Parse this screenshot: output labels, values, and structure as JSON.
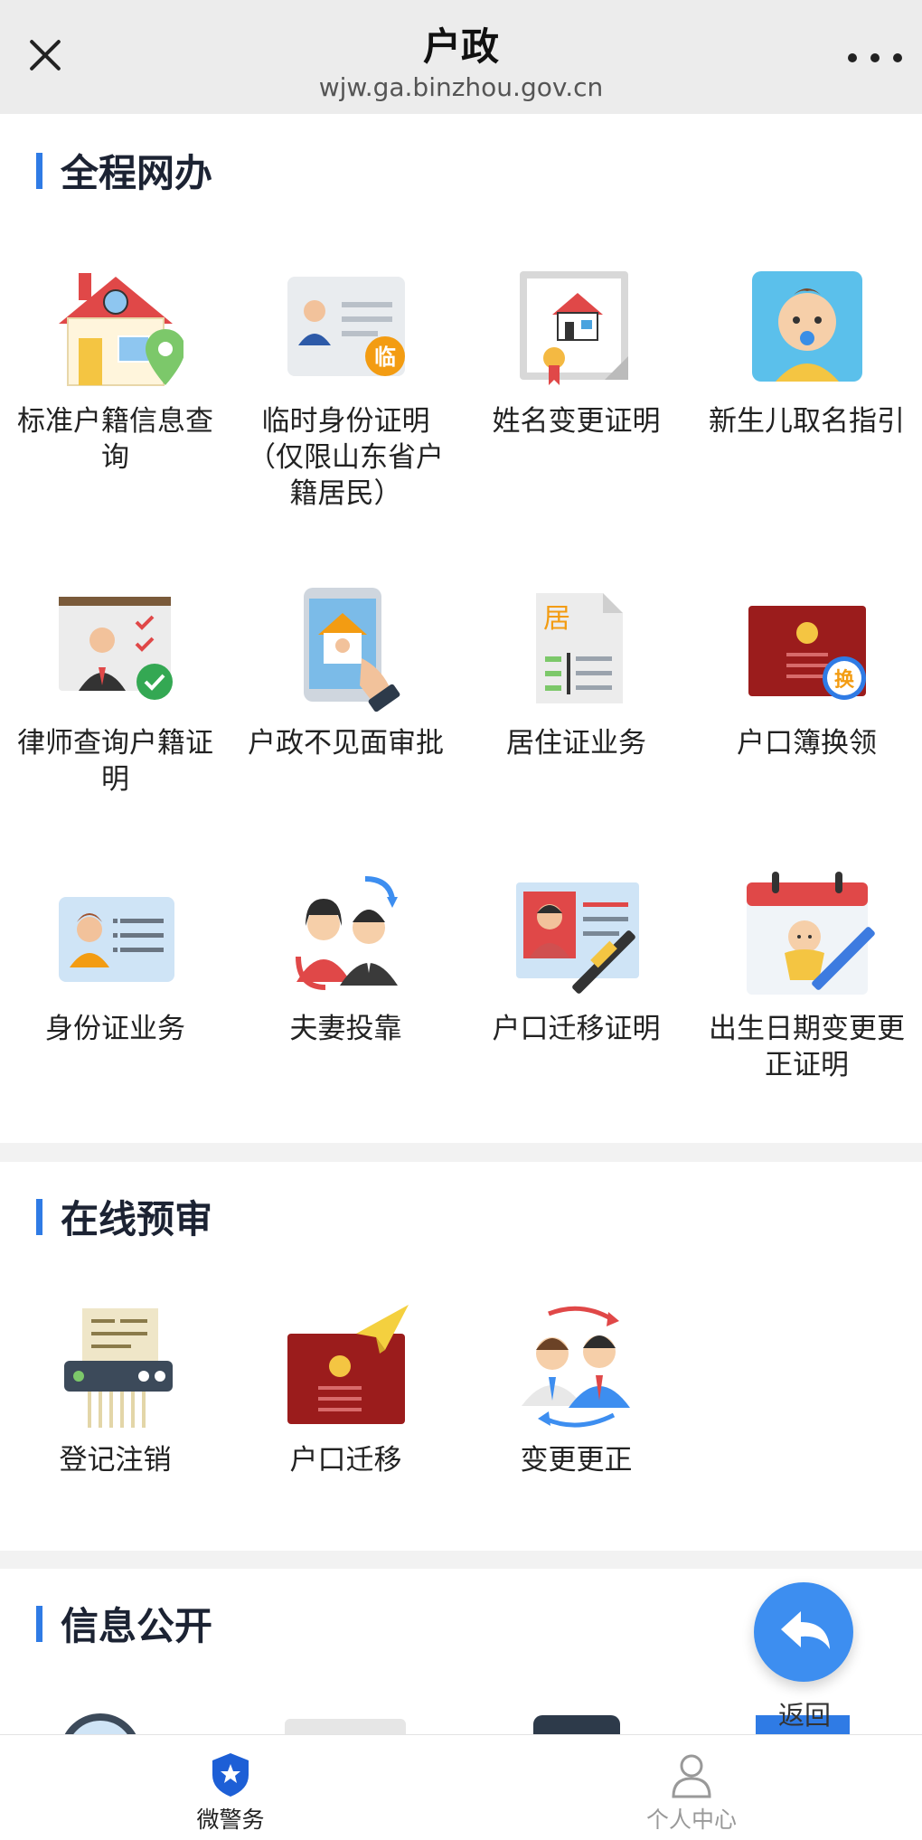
{
  "header": {
    "title": "户政",
    "url": "wjw.ga.binzhou.gov.cn"
  },
  "sections": {
    "full_online": {
      "title": "全程网办",
      "items": [
        {
          "label": "标准户籍信息查询",
          "icon": "house-location-icon"
        },
        {
          "label": "临时身份证明（仅限山东省户籍居民）",
          "icon": "temporary-id-card-icon"
        },
        {
          "label": "姓名变更证明",
          "icon": "certificate-house-icon"
        },
        {
          "label": "新生儿取名指引",
          "icon": "baby-icon"
        },
        {
          "label": "律师查询户籍证明",
          "icon": "lawyer-checklist-icon"
        },
        {
          "label": "户政不见面审批",
          "icon": "tablet-touch-icon"
        },
        {
          "label": "居住证业务",
          "icon": "residence-document-icon"
        },
        {
          "label": "户口簿换领",
          "icon": "household-book-exchange-icon"
        },
        {
          "label": "身份证业务",
          "icon": "id-card-icon"
        },
        {
          "label": "夫妻投靠",
          "icon": "couple-icon"
        },
        {
          "label": "户口迁移证明",
          "icon": "id-card-pen-icon"
        },
        {
          "label": "出生日期变更更正证明",
          "icon": "calendar-baby-icon"
        }
      ]
    },
    "online_review": {
      "title": "在线预审",
      "items": [
        {
          "label": "登记注销",
          "icon": "shredder-icon"
        },
        {
          "label": "户口迁移",
          "icon": "book-paper-plane-icon"
        },
        {
          "label": "变更更正",
          "icon": "people-swap-icon"
        }
      ]
    },
    "info_public": {
      "title": "信息公开"
    }
  },
  "float": {
    "return_label": "返回"
  },
  "bottom_nav": {
    "items": [
      {
        "label": "微警务",
        "active": true,
        "icon": "police-badge-icon"
      },
      {
        "label": "个人中心",
        "active": false,
        "icon": "person-icon"
      }
    ]
  },
  "colors": {
    "accent": "#2f7be5",
    "nav_active": "#1d5fd6",
    "nav_inactive": "#999999"
  }
}
